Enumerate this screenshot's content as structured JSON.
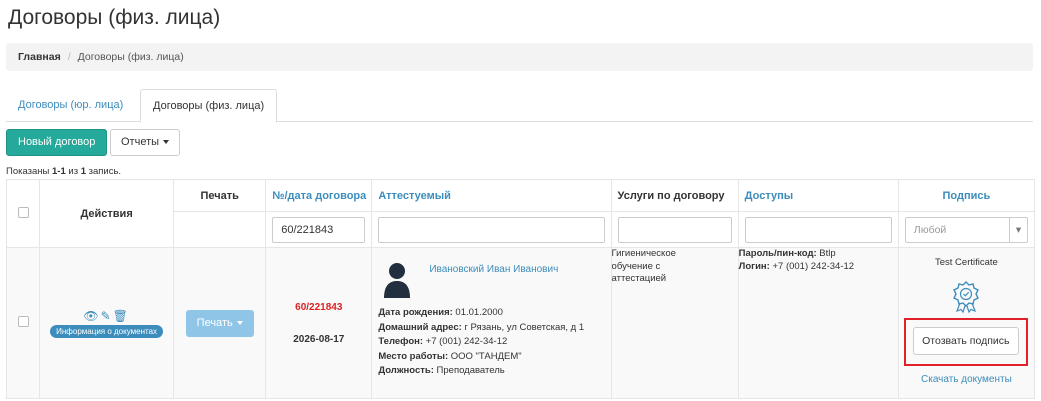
{
  "page": {
    "title": "Договоры (физ. лица)"
  },
  "breadcrumb": {
    "home": "Главная",
    "separator": "/",
    "current": "Договоры (физ. лица)"
  },
  "tabs": [
    {
      "label": "Договоры (юр. лица)",
      "active": false
    },
    {
      "label": "Договоры (физ. лица)",
      "active": true
    }
  ],
  "toolbar": {
    "new_contract": "Новый договор",
    "reports": "Отчеты"
  },
  "summary": {
    "prefix": "Показаны ",
    "range": "1-1",
    "middle": " из ",
    "total": "1",
    "suffix": " запись."
  },
  "table": {
    "headers": {
      "actions": "Действия",
      "print": "Печать",
      "contract": "№/дата договора",
      "person": "Аттестуемый",
      "services": "Услуги по договору",
      "access": "Доступы",
      "signature": "Подпись"
    },
    "filters": {
      "contract": "60/221843",
      "person": "",
      "services": "",
      "access": "",
      "signature_placeholder": "Любой"
    },
    "rows": [
      {
        "actions_badge": "Информация о документах",
        "print_button": "Печать",
        "contract_number": "60/221843",
        "contract_date": "2026-08-17",
        "person_name": "Ивановский Иван Иванович",
        "birth_label": "Дата рождения:",
        "birth_value": "01.01.2000",
        "address_label": "Домашний адрес:",
        "address_value": "г Рязань, ул Советская, д 1",
        "phone_label": "Телефон:",
        "phone_value": "+7 (001) 242-34-12",
        "work_label": "Место работы:",
        "work_value": "ООО \"ТАНДЕМ\"",
        "position_label": "Должность:",
        "position_value": "Преподаватель",
        "services_lines": [
          "Гигиеническое",
          "обучение с",
          "аттестацией"
        ],
        "pin_label": "Пароль/пин-код:",
        "pin_value": "Btlp",
        "login_label": "Логин:",
        "login_value": "+7 (001) 242-34-12",
        "cert_name": "Test Certificate",
        "revoke_button": "Отозвать подпись",
        "download_link": "Скачать документы"
      }
    ]
  },
  "colors": {
    "link": "#3c8dbc",
    "primary_green": "#25a99a",
    "highlight_red": "#e2202a",
    "contract_red": "#dd2222"
  }
}
